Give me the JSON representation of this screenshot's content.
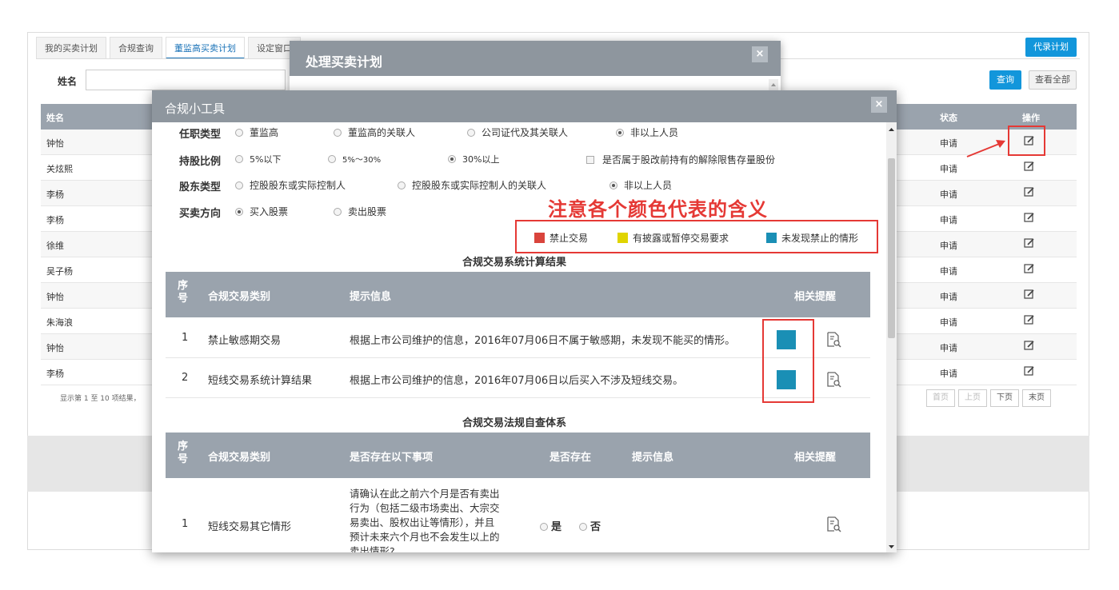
{
  "tabs": [
    "我的买卖计划",
    "合规查询",
    "董监高买卖计划",
    "设定窗口"
  ],
  "buttons": {
    "proxy_plan": "代录计划",
    "query": "查询",
    "view_all": "查看全部"
  },
  "search": {
    "name_label": "姓名"
  },
  "table": {
    "headers": {
      "name": "姓名",
      "status": "状态",
      "op": "操作"
    },
    "rows": [
      {
        "name": "钟怡",
        "status": "申请"
      },
      {
        "name": "关炫熙",
        "status": "申请"
      },
      {
        "name": "李杨",
        "status": "申请"
      },
      {
        "name": "李杨",
        "status": "申请"
      },
      {
        "name": "徐维",
        "status": "申请"
      },
      {
        "name": "吴子杨",
        "status": "申请"
      },
      {
        "name": "钟怡",
        "status": "申请"
      },
      {
        "name": "朱海浪",
        "status": "申请"
      },
      {
        "name": "钟怡",
        "status": "申请"
      },
      {
        "name": "李杨",
        "status": "申请"
      }
    ],
    "pager_info": "显示第 1 至 10 项结果，",
    "pager": [
      "首页",
      "上页",
      "下页",
      "末页"
    ]
  },
  "dialog_plan": {
    "title": "处理买卖计划",
    "close": "×"
  },
  "dialog_tool": {
    "title": "合规小工具",
    "close": "×",
    "rows": {
      "job": {
        "label": "任职类型",
        "options": [
          "董监高",
          "董监高的关联人",
          "公司证代及其关联人",
          "非以上人员"
        ]
      },
      "ratio": {
        "label": "持股比例",
        "options": [
          "5%以下",
          "5%～30%",
          "30%以上"
        ],
        "checkbox": "是否属于股改前持有的解除限售存量股份"
      },
      "holder": {
        "label": "股东类型",
        "options": [
          "控股股东或实际控制人",
          "控股股东或实际控制人的关联人",
          "非以上人员"
        ]
      },
      "direction": {
        "label": "买卖方向",
        "options": [
          "买入股票",
          "卖出股票"
        ]
      }
    },
    "annotation": "注意各个颜色代表的含义",
    "legend": [
      {
        "label": "禁止交易",
        "color": "#d9443c"
      },
      {
        "label": "有披露或暂停交易要求",
        "color": "#e0d400"
      },
      {
        "label": "未发现禁止的情形",
        "color": "#1a8fb5"
      }
    ],
    "section1": {
      "title": "合规交易系统计算结果",
      "headers": {
        "seq": "序号",
        "type": "合规交易类别",
        "info": "提示信息",
        "remind": "相关提醒"
      },
      "rows": [
        {
          "seq": "1",
          "type": "禁止敏感期交易",
          "info": "根据上市公司维护的信息，2016年07月06日不属于敏感期，未发现不能买的情形。"
        },
        {
          "seq": "2",
          "type": "短线交易系统计算结果",
          "info": "根据上市公司维护的信息，2016年07月06日以后买入不涉及短线交易。"
        }
      ]
    },
    "section2": {
      "title": "合规交易法规自查体系",
      "headers": {
        "seq": "序号",
        "type": "合规交易类别",
        "item": "是否存在以下事项",
        "exists": "是否存在",
        "info": "提示信息",
        "remind": "相关提醒"
      },
      "rows": [
        {
          "seq": "1",
          "type": "短线交易其它情形",
          "item_lines": [
            "请确认在此之前六个月是否有卖出",
            "行为（包括二级市场卖出、大宗交",
            "易卖出、股权出让等情形），并且",
            "预计未来六个月也不会发生以上的",
            "卖出情形?"
          ],
          "yes": "是",
          "no": "否"
        }
      ]
    }
  }
}
